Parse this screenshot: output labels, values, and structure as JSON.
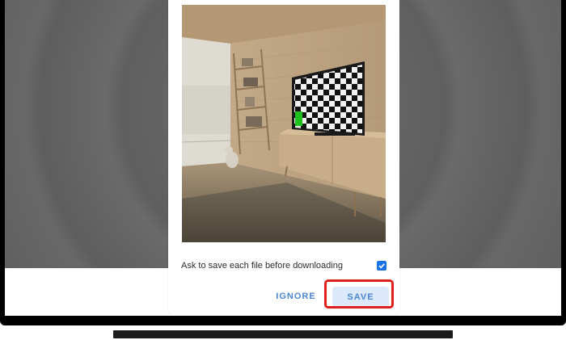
{
  "dialog": {
    "checkbox_label": "Ask to save each file before downloading",
    "checkbox_checked": true,
    "ignore_label": "IGNORE",
    "save_label": "SAVE"
  },
  "colors": {
    "accent": "#1a73e8",
    "button_text": "#4a86d4",
    "save_button_bg": "#dce9fb",
    "highlight_border": "#e01e1e"
  },
  "icons": {
    "checkbox": "check-icon"
  }
}
